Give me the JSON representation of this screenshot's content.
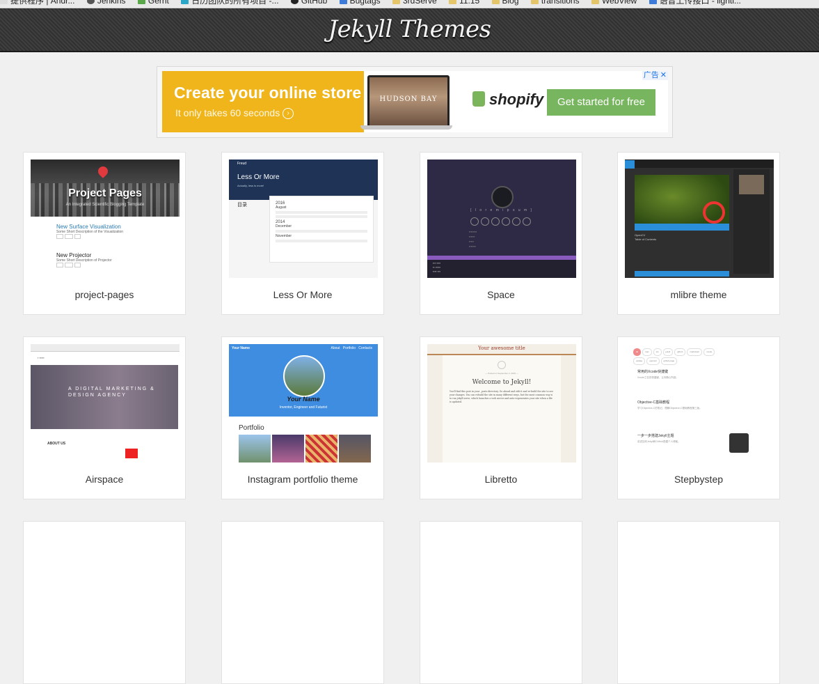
{
  "bookmarks": [
    {
      "label": "提供程序 | Andr...",
      "icon": "page-icon"
    },
    {
      "label": "Jenkins",
      "icon": "jenkins-icon"
    },
    {
      "label": "Gerrit",
      "icon": "gerrit-icon"
    },
    {
      "label": "日历团队的所有项目 -...",
      "icon": "project-icon"
    },
    {
      "label": "GitHub",
      "icon": "github-icon"
    },
    {
      "label": "Bugtags",
      "icon": "bugtags-icon"
    },
    {
      "label": "3rdServe",
      "icon": "folder-icon"
    },
    {
      "label": "11.15",
      "icon": "folder-icon"
    },
    {
      "label": "Blog",
      "icon": "folder-icon"
    },
    {
      "label": "transitions",
      "icon": "folder-icon"
    },
    {
      "label": "WebView",
      "icon": "folder-icon"
    },
    {
      "label": "语音上传接口 - lighti...",
      "icon": "page-icon"
    }
  ],
  "header": {
    "title": "Jekyll Themes"
  },
  "ad": {
    "headline": "Create your online store",
    "subline": "It only takes 60 seconds",
    "laptop_text": "HUDSON BAY",
    "brand": "shopify",
    "cta": "Get started for free",
    "badge": "广告",
    "colors": {
      "yellow": "#f0b51b",
      "green": "#77b55e"
    }
  },
  "themes": [
    {
      "name": "project-pages",
      "preview": {
        "title": "Project Pages",
        "subtitle": "An Integrated Scientific Blogging Template",
        "post1": "New Surface Visualization",
        "post1_desc": "Some Short Description of the Visualization",
        "post2": "New Projector",
        "post2_desc": "Some Short Description of Projector"
      }
    },
    {
      "name": "Less Or More",
      "preview": {
        "brand": "Freud",
        "title": "Less Or More",
        "subtitle": "Actually, less is more!",
        "toc": "目录",
        "year1": "2016",
        "month1": "August",
        "year2": "2014",
        "month2": "December",
        "month3": "November"
      }
    },
    {
      "name": "Space",
      "preview": {
        "handle": "[ l o r e m   i p s u m ]"
      }
    },
    {
      "name": "mlibre theme",
      "preview": {
        "logo": "OpenCV",
        "toc": "Table of Contents"
      }
    },
    {
      "name": "Airspace",
      "preview": {
        "hero": "A DIGITAL MARKETING & DESIGN AGENCY",
        "about": "ABOUT US"
      }
    },
    {
      "name": "Instagram portfolio theme",
      "preview": {
        "brand": "Your Name",
        "nav_about": "About",
        "nav_portfolio": "Portfolio",
        "nav_contact": "Contacts",
        "name": "Your Name",
        "tagline": "Inventor, Engineer and Futurist",
        "section": "Portfolio"
      }
    },
    {
      "name": "Libretto",
      "preview": {
        "site_title": "Your awesome title",
        "date": "— Posted on September 2, 2016 —",
        "post_title": "Welcome to Jekyll!",
        "body": "You'll find this post in your _posts directory. Go ahead and edit it and re-build the site to see your changes. You can rebuild the site in many different ways, but the most common way is to run jekyll serve, which launches a web server and auto-regenerates your site when a file is updated."
      }
    },
    {
      "name": "Stepbystep",
      "preview": {
        "tags": [
          "all",
          "mac",
          "ios",
          "jekyll",
          "github",
          "markdown",
          "xcode",
          "update",
          "openssl",
          "github page"
        ],
        "post1": "常用的Xcode快捷键",
        "post1_desc": "Xcode之名的快捷键，让你随心所欲。",
        "post2": "Objective-C基础教程",
        "post2_desc": "学习Objective-C的笔记，理解Objective-C基础教程第三版。",
        "post3": "一步一步搭建Jekyll主题",
        "post3_desc": "讲述如何Jekyll和GitHub搭建个人博客。"
      }
    }
  ]
}
